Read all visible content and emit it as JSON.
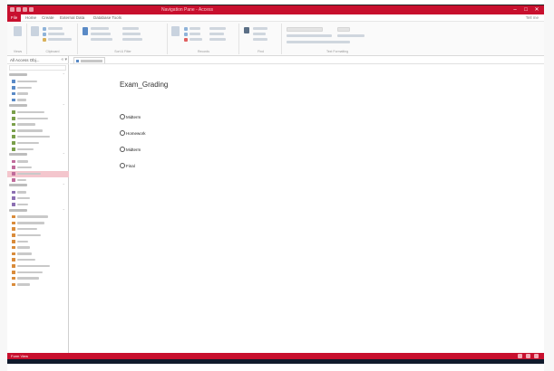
{
  "window": {
    "title": "Navigation Pane - Access",
    "controls": [
      "–",
      "□",
      "✕"
    ]
  },
  "ribbon_tabs": [
    "File",
    "Home",
    "Create",
    "External Data",
    "Database Tools"
  ],
  "tell_me": "Tell me",
  "ribbon_groups": [
    "Views",
    "Clipboard",
    "Sort & Filter",
    "Records",
    "Find",
    "Text Formatting"
  ],
  "nav": {
    "header": "All Access Obj...",
    "groups": [
      "Tables",
      "Queries",
      "Forms",
      "Reports",
      "Macros",
      "Modules"
    ]
  },
  "document_tab": "Exam_Grading",
  "form": {
    "title": "Exam_Grading",
    "options": [
      "Midterm",
      "Homework",
      "Midterm",
      "Final"
    ]
  },
  "status": {
    "text": "Form View"
  },
  "colors": {
    "accent": "#c8102e",
    "selected": "#f4c6cd"
  }
}
